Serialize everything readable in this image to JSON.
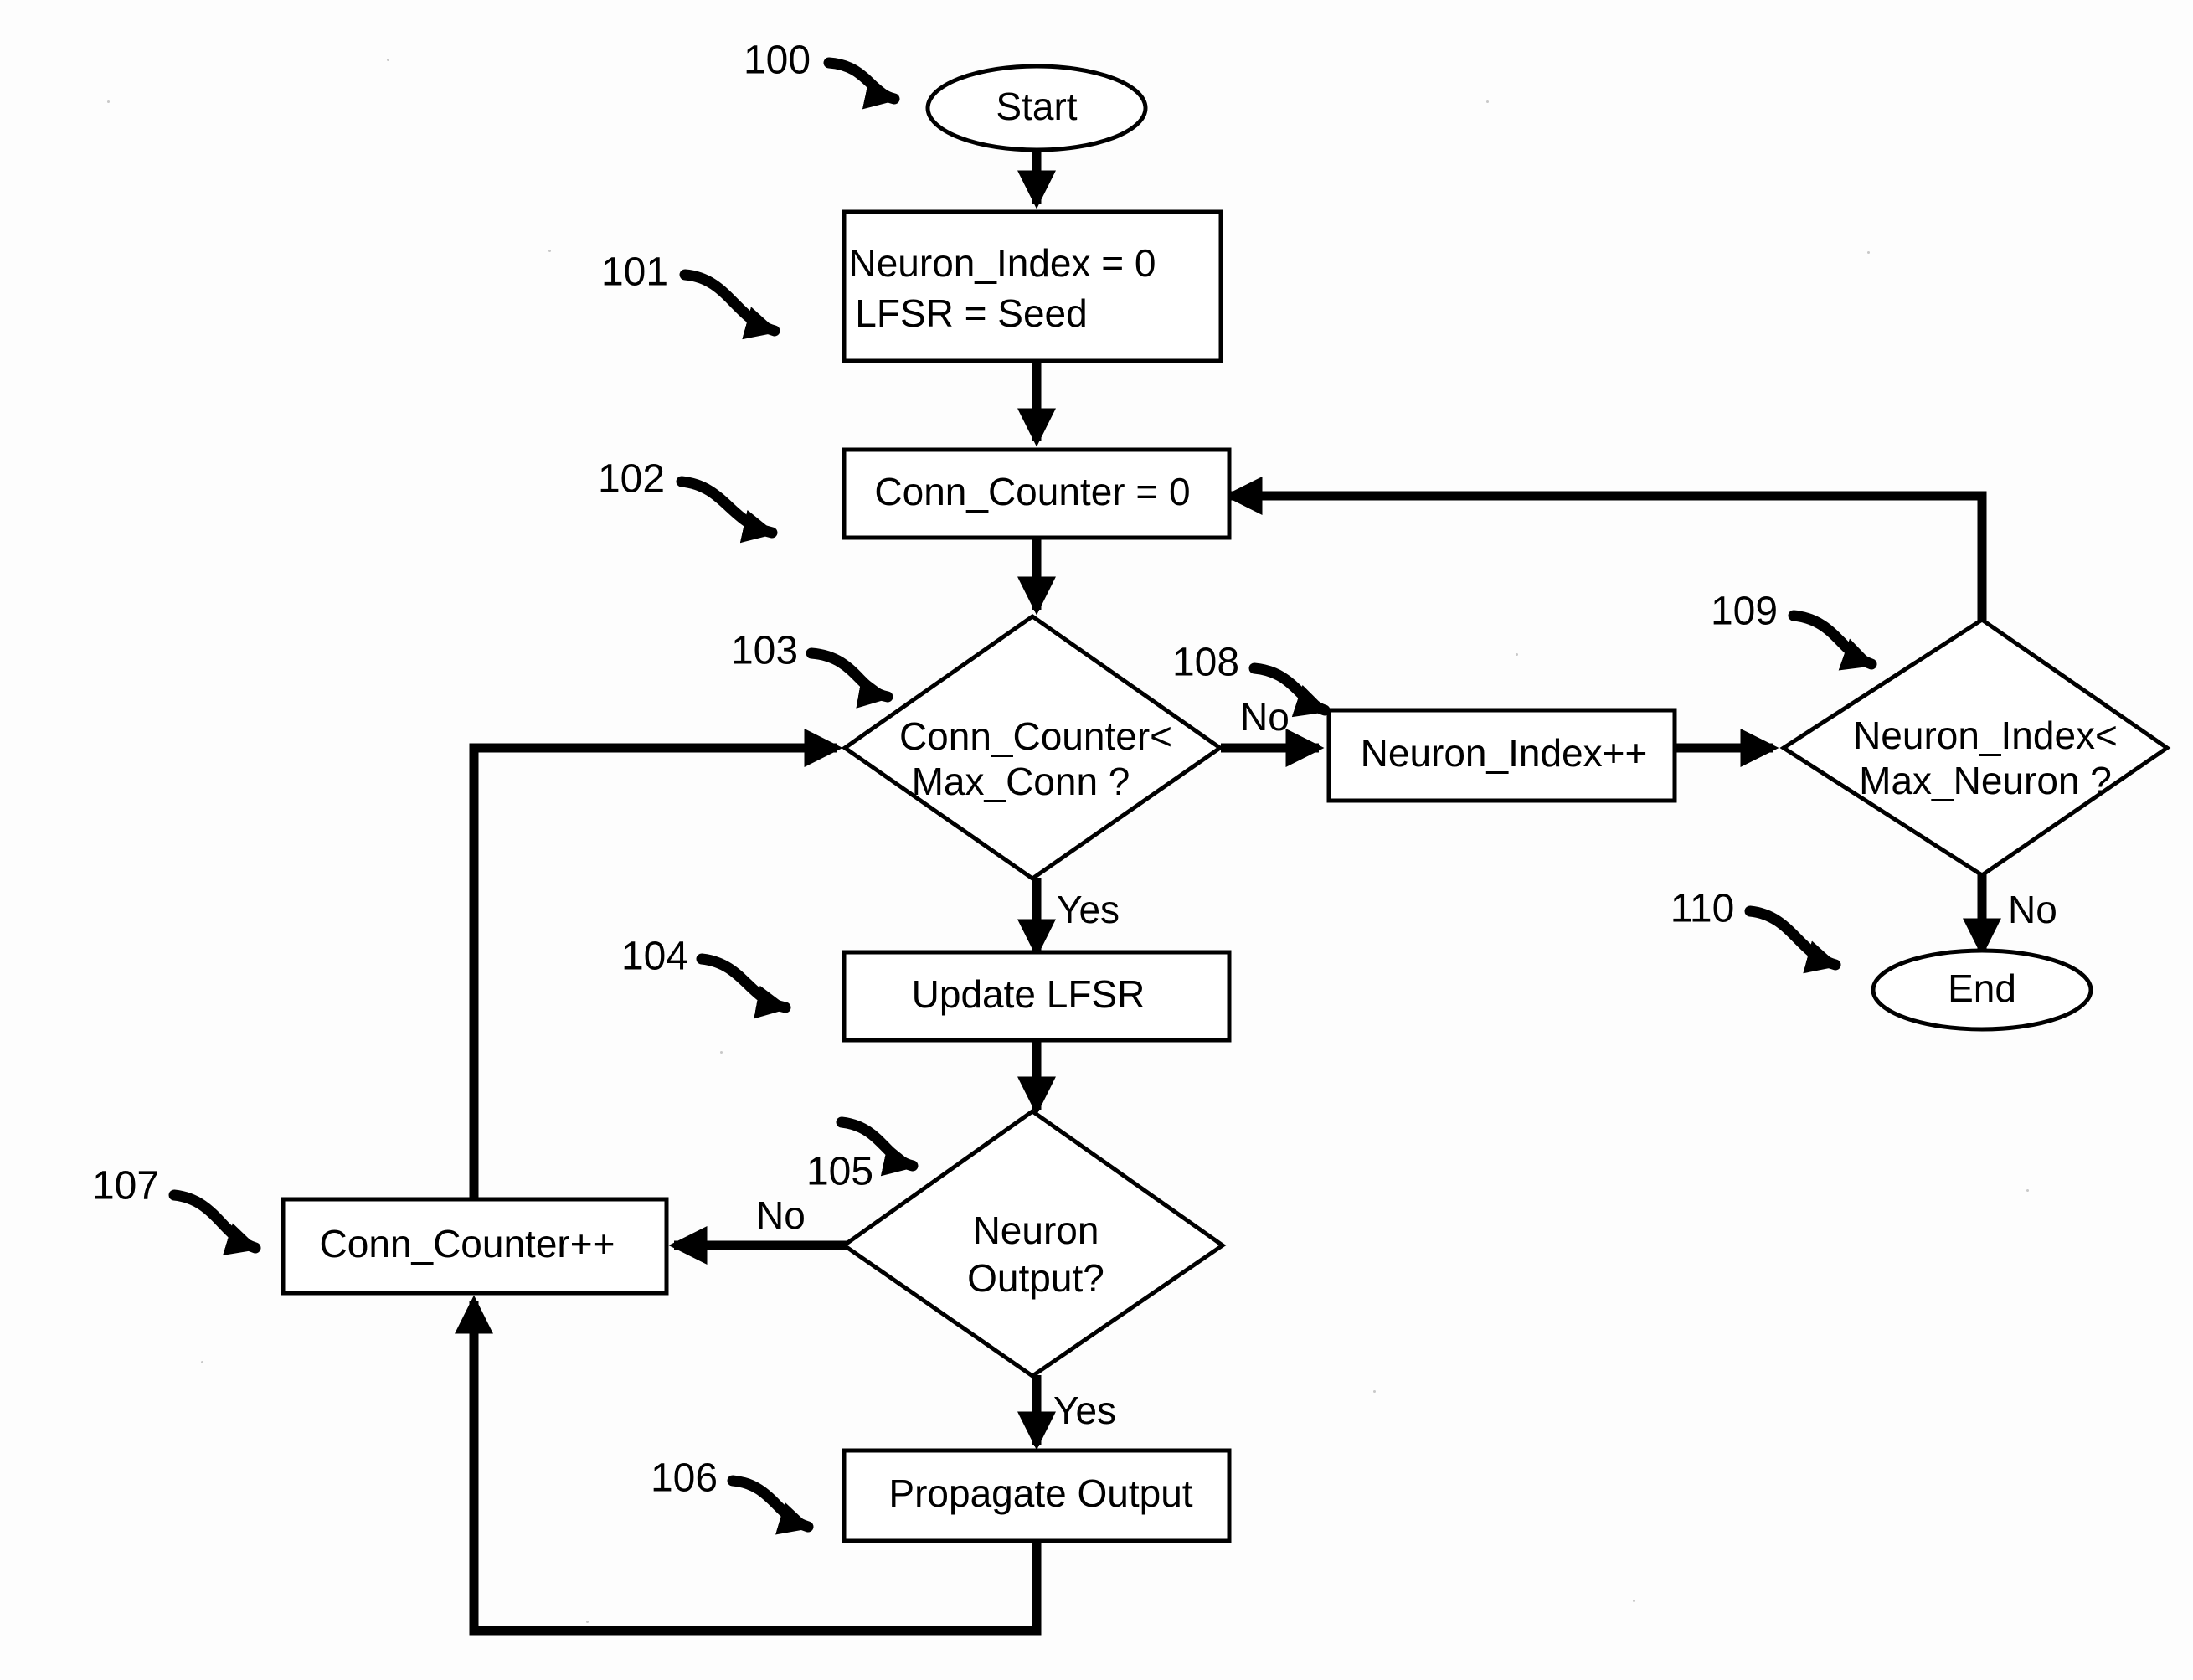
{
  "diagram": {
    "title": "LFSR-based neural network connection traversal flowchart",
    "type": "flowchart",
    "background_color": "#fdfdfd",
    "stroke_color": "#000000",
    "nodes": [
      {
        "id": "n100",
        "ref": "100",
        "shape": "ellipse",
        "label": "Start"
      },
      {
        "id": "n101",
        "ref": "101",
        "shape": "rect",
        "label_line1": "Neuron_Index = 0",
        "label_line2": "LFSR = Seed"
      },
      {
        "id": "n102",
        "ref": "102",
        "shape": "rect",
        "label": "Conn_Counter = 0"
      },
      {
        "id": "n103",
        "ref": "103",
        "shape": "diamond",
        "label_line1": "Conn_Counter<",
        "label_line2": "Max_Conn ?"
      },
      {
        "id": "n104",
        "ref": "104",
        "shape": "rect",
        "label": "Update LFSR"
      },
      {
        "id": "n105",
        "ref": "105",
        "shape": "diamond",
        "label_line1": "Neuron",
        "label_line2": "Output?"
      },
      {
        "id": "n106",
        "ref": "106",
        "shape": "rect",
        "label": "Propagate Output"
      },
      {
        "id": "n107",
        "ref": "107",
        "shape": "rect",
        "label": "Conn_Counter++"
      },
      {
        "id": "n108",
        "ref": "108",
        "shape": "rect",
        "label": "Neuron_Index++"
      },
      {
        "id": "n109",
        "ref": "109",
        "shape": "diamond",
        "label_line1": "Neuron_Index<",
        "label_line2": "Max_Neuron ?"
      },
      {
        "id": "n110",
        "ref": "110",
        "shape": "ellipse",
        "label": "End"
      }
    ],
    "edge_labels": {
      "d103_no": "No",
      "d103_yes": "Yes",
      "d105_no": "No",
      "d105_yes": "Yes",
      "d109_no": "No"
    },
    "ref_numbers": {
      "r100": "100",
      "r101": "101",
      "r102": "102",
      "r103": "103",
      "r104": "104",
      "r105": "105",
      "r106": "106",
      "r107": "107",
      "r108": "108",
      "r109": "109",
      "r110": "110"
    }
  }
}
